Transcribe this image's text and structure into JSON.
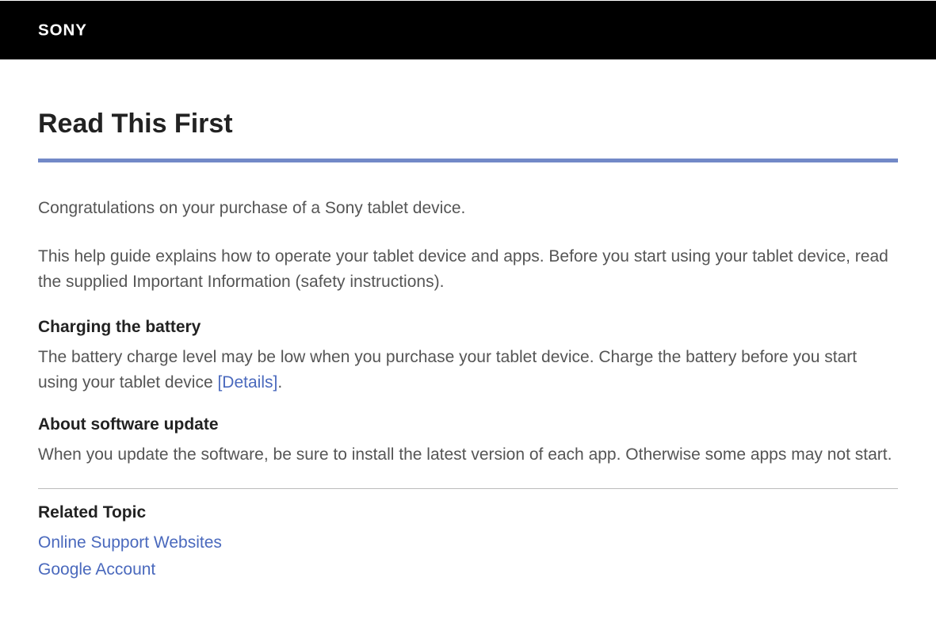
{
  "header": {
    "brand": "SONY"
  },
  "main": {
    "title": "Read This First",
    "intro_para1": "Congratulations on your purchase of a Sony tablet device.",
    "intro_para2": "This help guide explains how to operate your tablet device and apps. Before you start using your tablet device, read the supplied Important Information (safety instructions).",
    "sections": [
      {
        "heading": "Charging the battery",
        "text_before": "The battery charge level may be low when you purchase your tablet device. Charge the battery before you start using your tablet device ",
        "link_text": "[Details]",
        "text_after": "."
      },
      {
        "heading": "About software update",
        "text": "When you update the software, be sure to install the latest version of each app. Otherwise some apps may not start."
      }
    ],
    "related": {
      "heading": "Related Topic",
      "links": [
        "Online Support Websites",
        "Google Account"
      ]
    }
  }
}
